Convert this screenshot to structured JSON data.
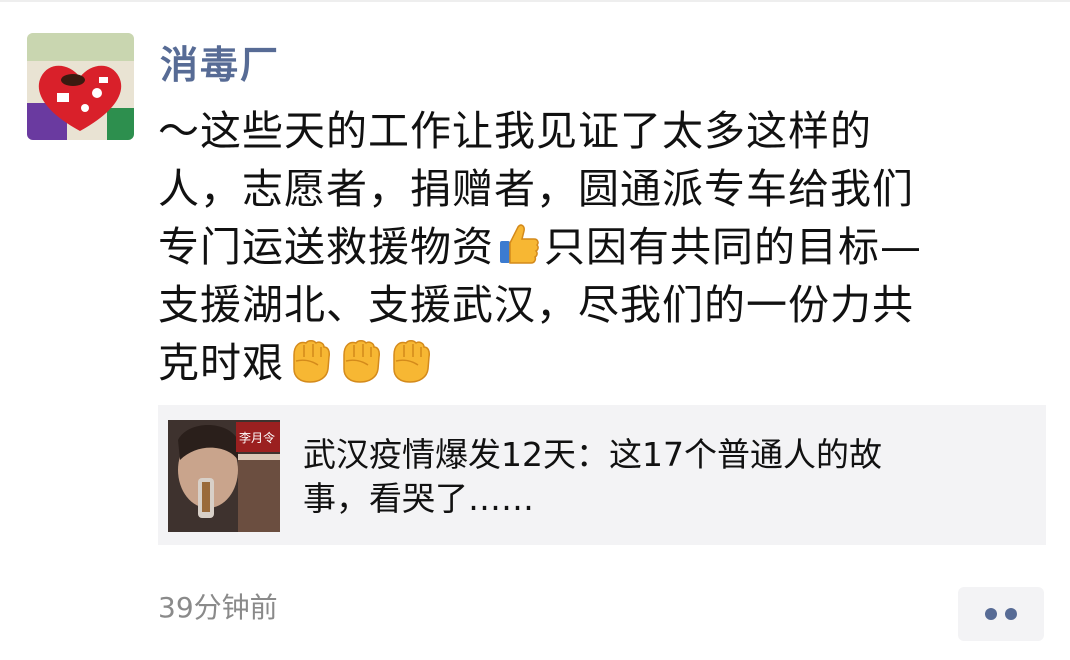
{
  "post": {
    "username": "消毒厂",
    "text_lines": [
      "～这些天的工作让我见证了太多这样的",
      "人，志愿者，捐赠者，圆通派专车给我们",
      "专门运送救援物资",
      "只因有共同的目标—",
      "支援湖北、支援武汉，尽我们的一份力共",
      "克时艰"
    ],
    "emojis": [
      "thumbs-up-icon",
      "fist-icon",
      "fist-icon",
      "fist-icon"
    ],
    "timestamp": "39分钟前"
  },
  "link_card": {
    "thumbnail_text": "李月令",
    "title_lines": [
      "武汉疫情爆发12天：这17个普通人的故",
      "事，看哭了……"
    ]
  },
  "colors": {
    "username": "#576b95",
    "text": "#111111",
    "timestamp": "#8a8a8a",
    "card_bg": "#f3f3f5"
  }
}
